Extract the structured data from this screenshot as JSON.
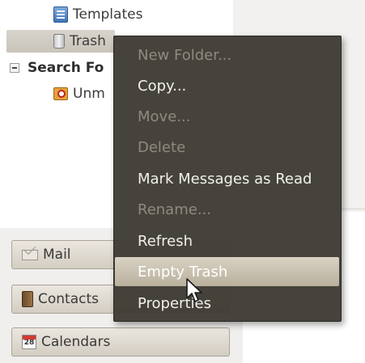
{
  "folder_tree": {
    "templates": {
      "label": "Templates",
      "icon": "templates-folder-icon"
    },
    "trash": {
      "label": "Trash",
      "icon": "trash-icon",
      "selected": true
    },
    "search_folders": {
      "label": "Search Fo",
      "expanded": true
    },
    "unmatched": {
      "label": "Unm",
      "icon": "search-folder-icon"
    }
  },
  "switcher": {
    "mail": {
      "label": "Mail",
      "icon": "mail-icon"
    },
    "contacts": {
      "label": "Contacts",
      "icon": "contacts-icon"
    },
    "calendars": {
      "label": "Calendars",
      "icon": "calendar-icon",
      "icon_text": "28"
    }
  },
  "context_menu": {
    "items": [
      {
        "label": "New Folder...",
        "enabled": false
      },
      {
        "label": "Copy...",
        "enabled": true
      },
      {
        "label": "Move...",
        "enabled": false
      },
      {
        "label": "Delete",
        "enabled": false
      },
      {
        "label": "Mark Messages as Read",
        "enabled": true
      },
      {
        "label": "Rename...",
        "enabled": false
      },
      {
        "label": "Refresh",
        "enabled": true
      },
      {
        "label": "Empty Trash",
        "enabled": true,
        "highlighted": true
      },
      {
        "label": "Properties",
        "enabled": true
      }
    ]
  },
  "colors": {
    "menu_background": "#3e3b34",
    "menu_text": "#f2f0ec",
    "menu_disabled_text": "#8f8a80",
    "menu_highlight": "#c9c1af",
    "selected_row": "#d0cbc2"
  }
}
